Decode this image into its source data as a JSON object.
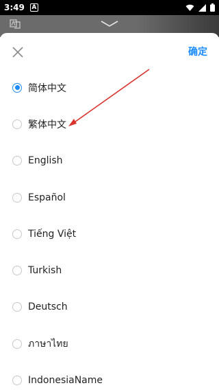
{
  "status_bar": {
    "time": "3:49",
    "app_badge": "A"
  },
  "header": {
    "confirm_label": "确定"
  },
  "languages": [
    {
      "label": "简体中文",
      "selected": true
    },
    {
      "label": "繁体中文",
      "selected": false
    },
    {
      "label": "English",
      "selected": false
    },
    {
      "label": "Español",
      "selected": false
    },
    {
      "label": "Tiếng Việt",
      "selected": false
    },
    {
      "label": "Turkish",
      "selected": false
    },
    {
      "label": "Deutsch",
      "selected": false
    },
    {
      "label": "ภาษาไทย",
      "selected": false
    },
    {
      "label": "IndonesiaName",
      "selected": false
    }
  ],
  "colors": {
    "accent": "#1a8cff",
    "annotation_arrow": "#d9312b"
  },
  "icons": [
    "translate-icon",
    "chevron-down-icon",
    "close-icon",
    "wifi-icon",
    "signal-icon",
    "battery-icon"
  ]
}
